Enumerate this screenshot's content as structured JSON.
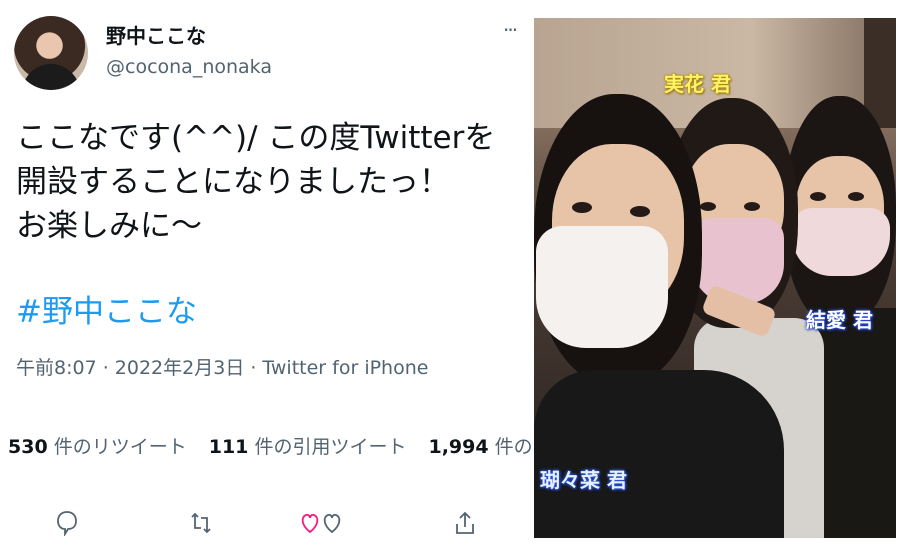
{
  "tweet": {
    "author": {
      "display_name": "野中ここな",
      "handle": "@cocona_nonaka"
    },
    "more_label": "···",
    "text_lines": [
      "ここなです(^^)/  この度Twitterを",
      "開設することになりましたっ！",
      "お楽しみに〜"
    ],
    "hashtag": "#野中ここな",
    "meta": "午前8:07 · 2022年2月3日 · Twitter for iPhone",
    "stats": {
      "retweets": {
        "count": "530",
        "label": "件のリツイート"
      },
      "quotes": {
        "count": "111",
        "label": "件の引用ツイート"
      },
      "likes": {
        "count": "1,994",
        "label": "件のいいね"
      }
    },
    "actions": [
      {
        "icon": "reply-icon"
      },
      {
        "icon": "retweet-icon"
      },
      {
        "icon": "like-icon"
      },
      {
        "icon": "share-icon"
      }
    ],
    "colors": {
      "link": "#1d9bf0",
      "secondary": "#536471",
      "like": "#f91880"
    }
  },
  "photo": {
    "labels": {
      "top": "実花 君",
      "right": "結愛 君",
      "bottom_left": "瑚々菜 君"
    }
  }
}
